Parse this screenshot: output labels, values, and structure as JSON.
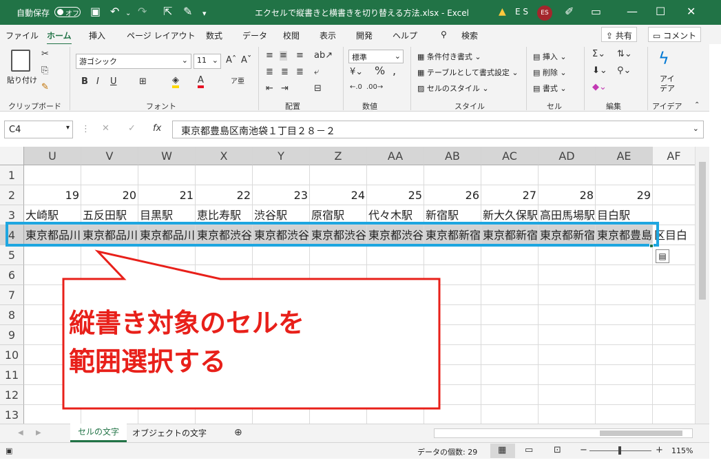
{
  "title_bar": {
    "autosave_label": "自動保存",
    "autosave_state": "オフ",
    "document_title": "エクセルで縦書きと横書きを切り替える方法.xlsx - Excel",
    "warning_icon": "warning-icon",
    "user_initials": "E S",
    "avatar_text": "ES"
  },
  "menu": {
    "items": [
      "ファイル",
      "ホーム",
      "挿入",
      "ページ レイアウト",
      "数式",
      "データ",
      "校閲",
      "表示",
      "開発",
      "ヘルプ"
    ],
    "active": "ホーム",
    "search": "検索",
    "share": "共有",
    "comment": "コメント"
  },
  "ribbon": {
    "clipboard": {
      "paste": "貼り付け",
      "group": "クリップボード"
    },
    "font": {
      "name": "游ゴシック",
      "size": "11",
      "group": "フォント",
      "bold": "B",
      "italic": "I",
      "underline": "U"
    },
    "alignment": {
      "group": "配置"
    },
    "number": {
      "format": "標準",
      "group": "数値"
    },
    "styles": {
      "conditional": "条件付き書式",
      "table": "テーブルとして書式設定",
      "cell_styles": "セルのスタイル",
      "group": "スタイル"
    },
    "cells": {
      "insert": "挿入",
      "delete": "削除",
      "format": "書式",
      "group": "セル"
    },
    "editing": {
      "group": "編集"
    },
    "ideas": {
      "label1": "アイ",
      "label2": "デア",
      "group": "アイデア"
    }
  },
  "formula_bar": {
    "name_box": "C4",
    "fx": "fx",
    "formula": "東京都豊島区南池袋１丁目２８－２"
  },
  "sheet": {
    "columns": [
      "U",
      "V",
      "W",
      "X",
      "Y",
      "Z",
      "AA",
      "AB",
      "AC",
      "AD",
      "AE",
      "AF"
    ],
    "rows": [
      "1",
      "2",
      "3",
      "4",
      "5",
      "6",
      "7",
      "8",
      "9",
      "10",
      "11",
      "12",
      "13"
    ],
    "row2": [
      "19",
      "20",
      "21",
      "22",
      "23",
      "24",
      "25",
      "26",
      "27",
      "28",
      "29",
      ""
    ],
    "row3": [
      "大崎駅",
      "五反田駅",
      "目黒駅",
      "恵比寿駅",
      "渋谷駅",
      "原宿駅",
      "代々木駅",
      "新宿駅",
      "新大久保駅",
      "高田馬場駅",
      "目白駅",
      ""
    ],
    "row4": [
      "東京都品川",
      "東京都品川",
      "東京都品川",
      "東京都渋谷",
      "東京都渋谷",
      "東京都渋谷",
      "東京都渋谷",
      "東京都新宿",
      "東京都新宿",
      "東京都新宿",
      "東京都豊島",
      "区目白"
    ]
  },
  "callout": {
    "line1": "縦書き対象のセルを",
    "line2": "範囲選択する",
    "text_color": "#e8201a",
    "border_color": "#e8201a",
    "highlight_color": "#1ea6e0"
  },
  "sheet_tabs": {
    "active": "セルの文字",
    "other": "オブジェクトの文字"
  },
  "status_bar": {
    "count": "データの個数: 29",
    "zoom": "115%"
  },
  "colors": {
    "excel_green": "#217346"
  }
}
